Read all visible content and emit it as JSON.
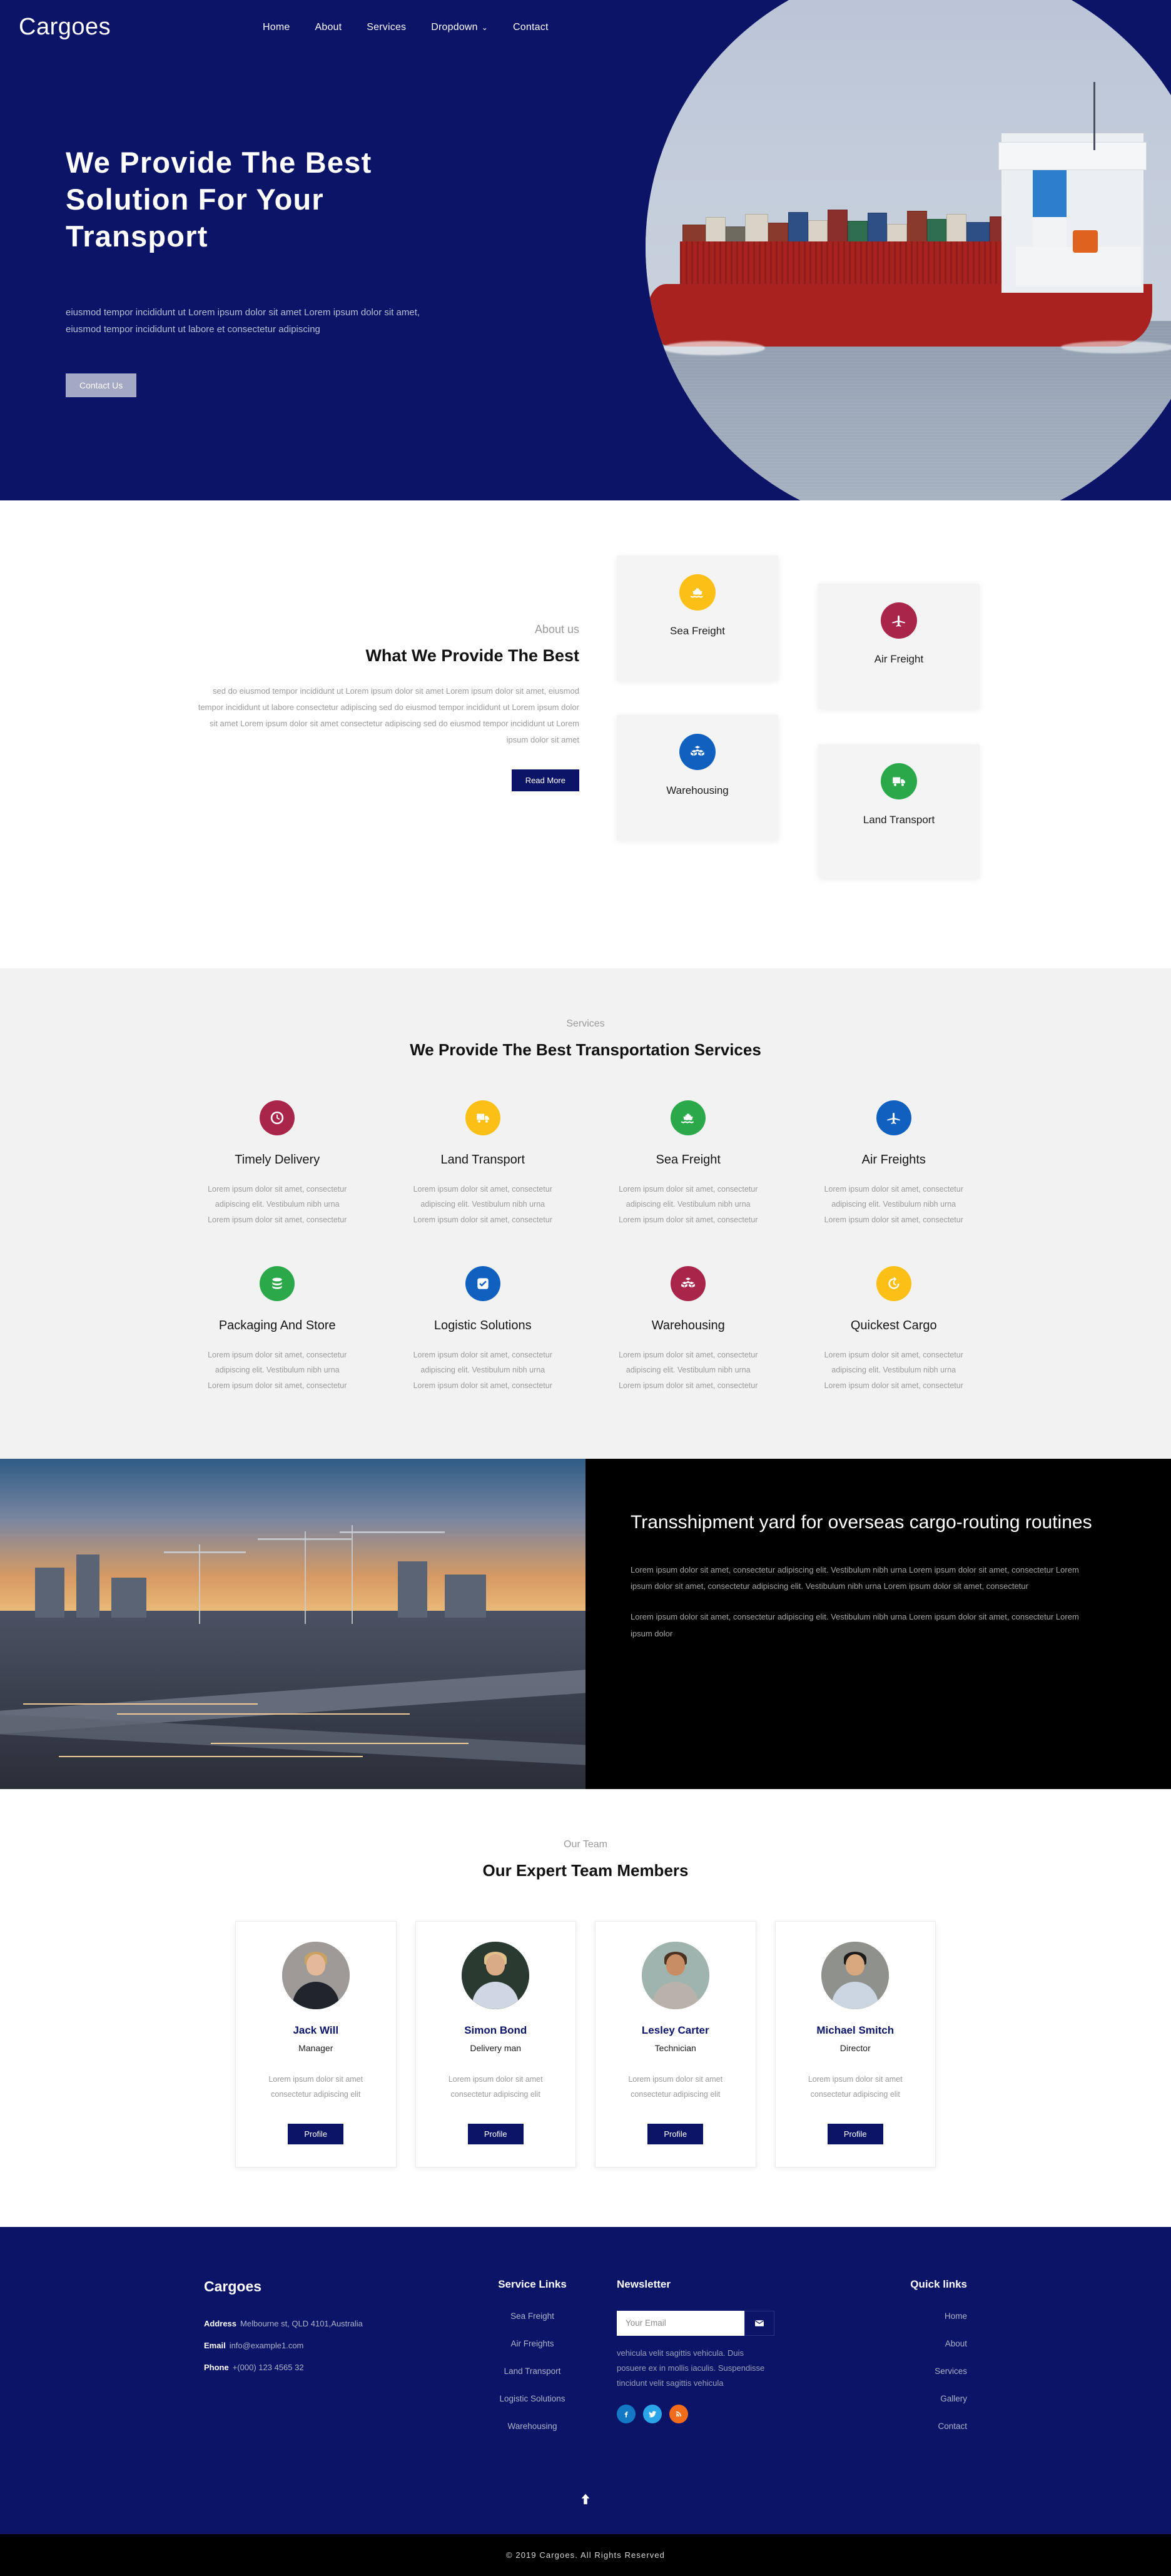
{
  "brand": "Cargoes",
  "nav": {
    "items": [
      {
        "label": "Home"
      },
      {
        "label": "About"
      },
      {
        "label": "Services"
      },
      {
        "label": "Dropdown",
        "caret": "⌄"
      },
      {
        "label": "Contact"
      }
    ]
  },
  "hero": {
    "title": "We Provide The Best Solution For Your Transport",
    "subtitle": "eiusmod tempor incididunt ut Lorem ipsum dolor sit amet Lorem ipsum dolor sit amet, eiusmod tempor incididunt ut labore et consectetur adipiscing",
    "cta": "Contact Us",
    "image_alt": "container-ship-navi-baltic"
  },
  "about": {
    "kicker": "About us",
    "title": "What We Provide The Best",
    "text": "sed do eiusmod tempor incididunt ut Lorem ipsum dolor sit amet Lorem ipsum dolor sit amet, eiusmod tempor incididunt ut labore consectetur adipiscing sed do eiusmod tempor incididunt ut Lorem ipsum dolor sit amet Lorem ipsum dolor sit amet consectetur adipiscing sed do eiusmod tempor incididunt ut Lorem ipsum dolor sit amet",
    "cta": "Read More",
    "cards": [
      {
        "label": "Sea Freight",
        "icon": "ship-icon",
        "color": "#fcbf15"
      },
      {
        "label": "Air Freight",
        "icon": "plane-icon",
        "color": "#a9254a"
      },
      {
        "label": "Warehousing",
        "icon": "boxes-icon",
        "color": "#1060c0"
      },
      {
        "label": "Land Transport",
        "icon": "truck-icon",
        "color": "#2aa84a"
      }
    ]
  },
  "services": {
    "kicker": "Services",
    "title": "We Provide The Best Transportation Services",
    "body_short": "Lorem ipsum dolor sit amet, consectetur adipiscing elit. Vestibulum nibh urna Lorem ipsum dolor sit amet, consectetur",
    "items": [
      {
        "title": "Timely Delivery",
        "icon": "clock-icon",
        "color": "#a9254a"
      },
      {
        "title": "Land Transport",
        "icon": "truck-icon",
        "color": "#fcbf15"
      },
      {
        "title": "Sea Freight",
        "icon": "ship-icon",
        "color": "#2aa84a"
      },
      {
        "title": "Air Freights",
        "icon": "plane-icon",
        "color": "#1060c0"
      },
      {
        "title": "Packaging And Store",
        "icon": "database-icon",
        "color": "#2aa84a"
      },
      {
        "title": "Logistic Solutions",
        "icon": "checkbox-icon",
        "color": "#1060c0"
      },
      {
        "title": "Warehousing",
        "icon": "boxes-icon",
        "color": "#a9254a"
      },
      {
        "title": "Quickest Cargo",
        "icon": "history-icon",
        "color": "#fcbf15"
      }
    ]
  },
  "transshipment": {
    "title": "Transshipment yard for overseas cargo-routing routines",
    "paragraph1": "Lorem ipsum dolor sit amet, consectetur adipiscing elit. Vestibulum nibh urna Lorem ipsum dolor sit amet, consectetur Lorem ipsum dolor sit amet, consectetur adipiscing elit. Vestibulum nibh urna Lorem ipsum dolor sit amet, consectetur",
    "paragraph2": "Lorem ipsum dolor sit amet, consectetur adipiscing elit. Vestibulum nibh urna Lorem ipsum dolor sit amet, consectetur Lorem ipsum dolor",
    "image_alt": "port-terminal-at-sunset"
  },
  "team": {
    "kicker": "Our Team",
    "title": "Our Expert Team Members",
    "desc": "Lorem ipsum dolor sit amet consectetur adipiscing elit",
    "profile_label": "Profile",
    "members": [
      {
        "name": "Jack Will",
        "role": "Manager",
        "skin": "#e3b99a",
        "hair": "#caa164",
        "cloth": "#22242c",
        "bg": "#9e9a97"
      },
      {
        "name": "Simon Bond",
        "role": "Delivery man",
        "skin": "#d9ab86",
        "hair": "#e0c08a",
        "cloth": "#cfd8e2",
        "bg": "#2a3a30"
      },
      {
        "name": "Lesley Carter",
        "role": "Technician",
        "skin": "#c98d66",
        "hair": "#4a3122",
        "cloth": "#b9b2aa",
        "bg": "#9fb4ae"
      },
      {
        "name": "Michael Smitch",
        "role": "Director",
        "skin": "#d7a87e",
        "hair": "#1d1b1a",
        "cloth": "#cbd6e0",
        "bg": "#8f918d"
      }
    ]
  },
  "footer": {
    "brand": "Cargoes",
    "contact": [
      {
        "label": "Address",
        "value": "Melbourne st, QLD 4101,Australia"
      },
      {
        "label": "Email",
        "value": "info@example1.com"
      },
      {
        "label": "Phone",
        "value": "+(000) 123 4565 32"
      }
    ],
    "service_links": {
      "title": "Service Links",
      "items": [
        "Sea Freight",
        "Air Freights",
        "Land Transport",
        "Logistic Solutions",
        "Warehousing"
      ]
    },
    "newsletter": {
      "title": "Newsletter",
      "placeholder": "Your Email",
      "text": "vehicula velit sagittis vehicula. Duis posuere ex in mollis iaculis. Suspendisse tincidunt velit sagittis vehicula",
      "socials": [
        {
          "name": "facebook-icon",
          "color": "#1479c4"
        },
        {
          "name": "twitter-icon",
          "color": "#2aa6e8"
        },
        {
          "name": "rss-icon",
          "color": "#f26c1c"
        }
      ]
    },
    "quick_links": {
      "title": "Quick links",
      "items": [
        "Home",
        "About",
        "Services",
        "Gallery",
        "Contact"
      ]
    },
    "to_top": "scroll-to-top",
    "copyright": "© 2019 Cargoes. All Rights Reserved"
  },
  "colors": {
    "navy": "#0b1466",
    "black": "#000000",
    "grey_bg": "#f2f2f2",
    "muted": "#9b9b9b"
  }
}
